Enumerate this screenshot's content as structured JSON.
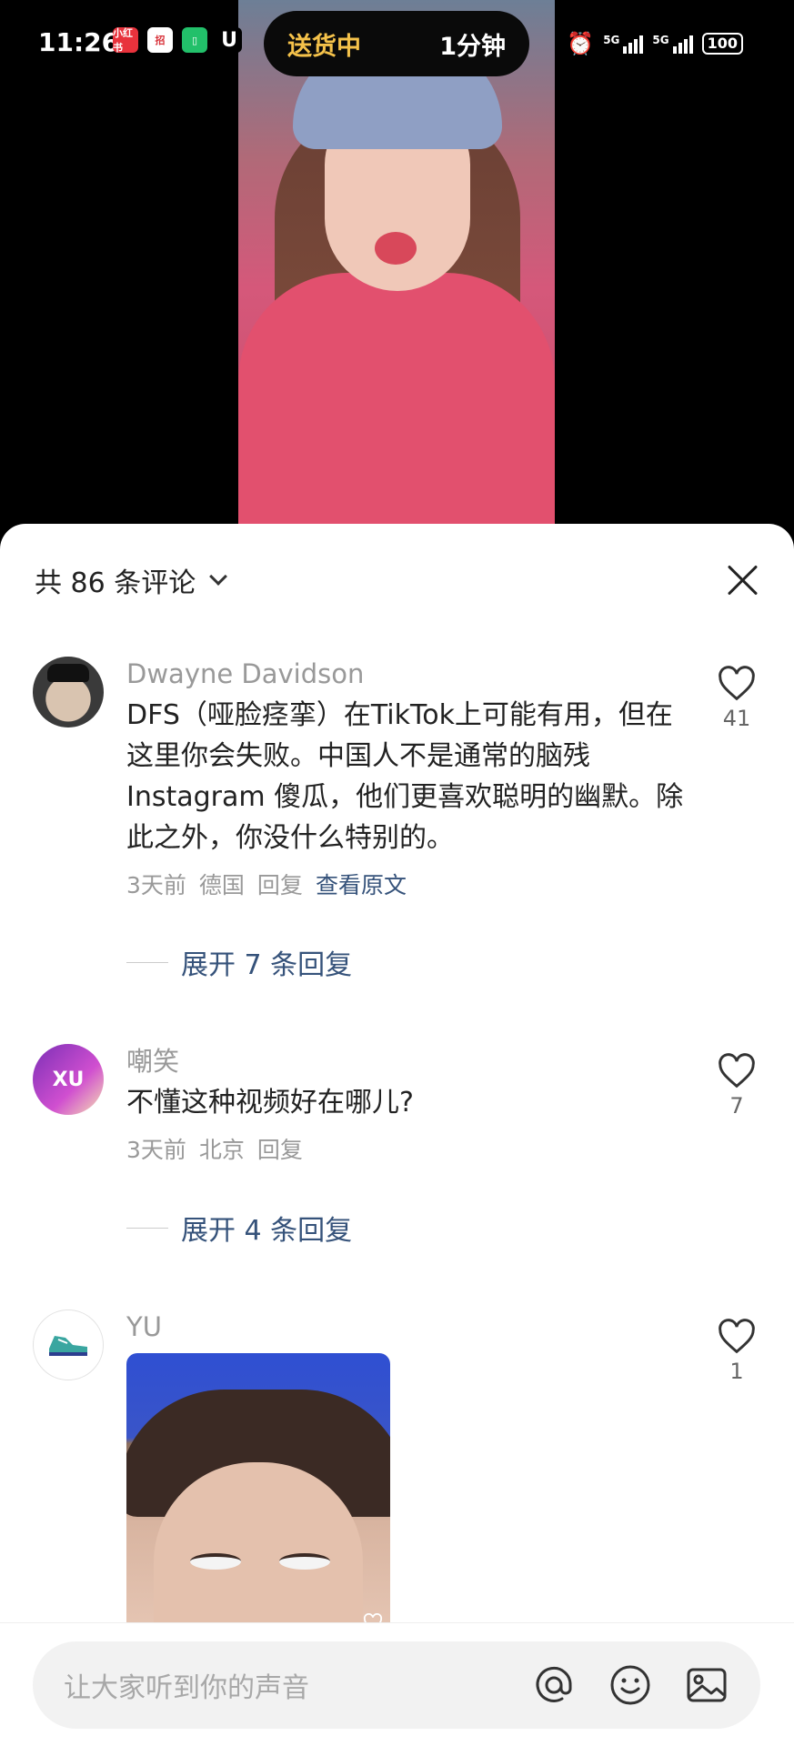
{
  "status_bar": {
    "time": "11:26",
    "notif_icons": [
      {
        "name": "xiaohongshu-app-icon",
        "label": "小红书",
        "color": "#e8323c"
      },
      {
        "name": "cmb-bank-app-icon",
        "label": "招",
        "color": "#d8323a"
      },
      {
        "name": "green-app-icon",
        "label": "",
        "color": "#22c06a"
      },
      {
        "name": "magnet-app-icon",
        "label": "",
        "color": "#000000"
      }
    ],
    "delivery_status": "送货中",
    "delivery_eta": "1分钟",
    "signal_label_1": "5G",
    "signal_label_2": "5G",
    "battery": "100"
  },
  "comments_header": {
    "title": "共 86 条评论"
  },
  "comments": [
    {
      "username": "Dwayne Davidson",
      "text": "DFS（哑脸痉挛）在TikTok上可能有用，但在这里你会失败。中国人不是通常的脑残 Instagram 傻瓜，他们更喜欢聪明的幽默。除此之外，你没什么特别的。",
      "time": "3天前",
      "location": "德国",
      "reply_label": "回复",
      "translate_label": "查看原文",
      "likes": "41",
      "expand_label": "展开 7 条回复"
    },
    {
      "username": "嘲笑",
      "avatar_text": "XU",
      "text": "不懂这种视频好在哪儿?",
      "time": "3天前",
      "location": "北京",
      "reply_label": "回复",
      "likes": "7",
      "expand_label": "展开 4 条回复"
    },
    {
      "username": "YU",
      "likes": "1"
    }
  ],
  "input": {
    "placeholder": "让大家听到你的声音"
  }
}
